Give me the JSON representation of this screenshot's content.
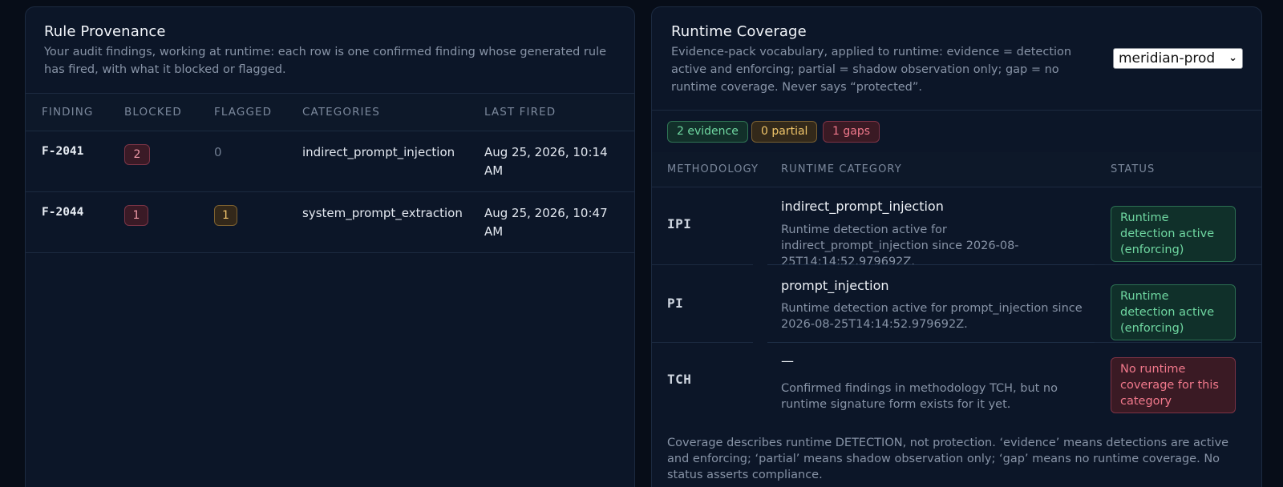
{
  "left_panel": {
    "title": "Rule Provenance",
    "description": "Your audit findings, working at runtime: each row is one confirmed finding whose generated rule has fired, with what it blocked or flagged.",
    "columns": [
      "FINDING",
      "BLOCKED",
      "FLAGGED",
      "CATEGORIES",
      "LAST FIRED"
    ],
    "rows": [
      {
        "finding": "F-2041",
        "blocked": "2",
        "flagged": "0",
        "categories": "indirect_prompt_injection",
        "last_fired": "Aug 25, 2026, 10:14 AM"
      },
      {
        "finding": "F-2044",
        "blocked": "1",
        "flagged": "1",
        "categories": "system_prompt_extraction",
        "last_fired": "Aug 25, 2026, 10:47 AM"
      }
    ]
  },
  "right_panel": {
    "title": "Runtime Coverage",
    "description": "Evidence-pack vocabulary, applied to runtime: evidence = detection active and enforcing; partial = shadow observation only; gap = no runtime coverage. Never says “protected”.",
    "environment_select": {
      "selected": "meridian-prod"
    },
    "summary": {
      "evidence": "2 evidence",
      "partial": "0 partial",
      "gaps": "1 gaps"
    },
    "columns": [
      "METHODOLOGY",
      "RUNTIME CATEGORY",
      "STATUS"
    ],
    "rows": [
      {
        "methodology": "IPI",
        "category": "indirect_prompt_injection",
        "detail": "Runtime detection active for indirect_prompt_injection since 2026-08-25T14:14:52.979692Z.",
        "status": "Runtime detection active (enforcing)"
      },
      {
        "methodology": "PI",
        "category": "prompt_injection",
        "detail": "Runtime detection active for prompt_injection since 2026-08-25T14:14:52.979692Z.",
        "status": "Runtime detection active (enforcing)"
      },
      {
        "methodology": "TCH",
        "category": "—",
        "detail": "Confirmed findings in methodology TCH, but no runtime signature form exists for it yet.",
        "status": "No runtime coverage for this category"
      }
    ],
    "footnote": "Coverage describes runtime DETECTION, not protection. ‘evidence’ means detections are active and enforcing; ‘partial’ means shadow observation only; ‘gap’ means no runtime coverage. No status asserts compliance."
  },
  "colors": {
    "background": "#070d18",
    "panel": "#0c1628",
    "evidence_green": "#6fd7a1",
    "partial_amber": "#f0c56a",
    "gap_red": "#f0788b"
  }
}
